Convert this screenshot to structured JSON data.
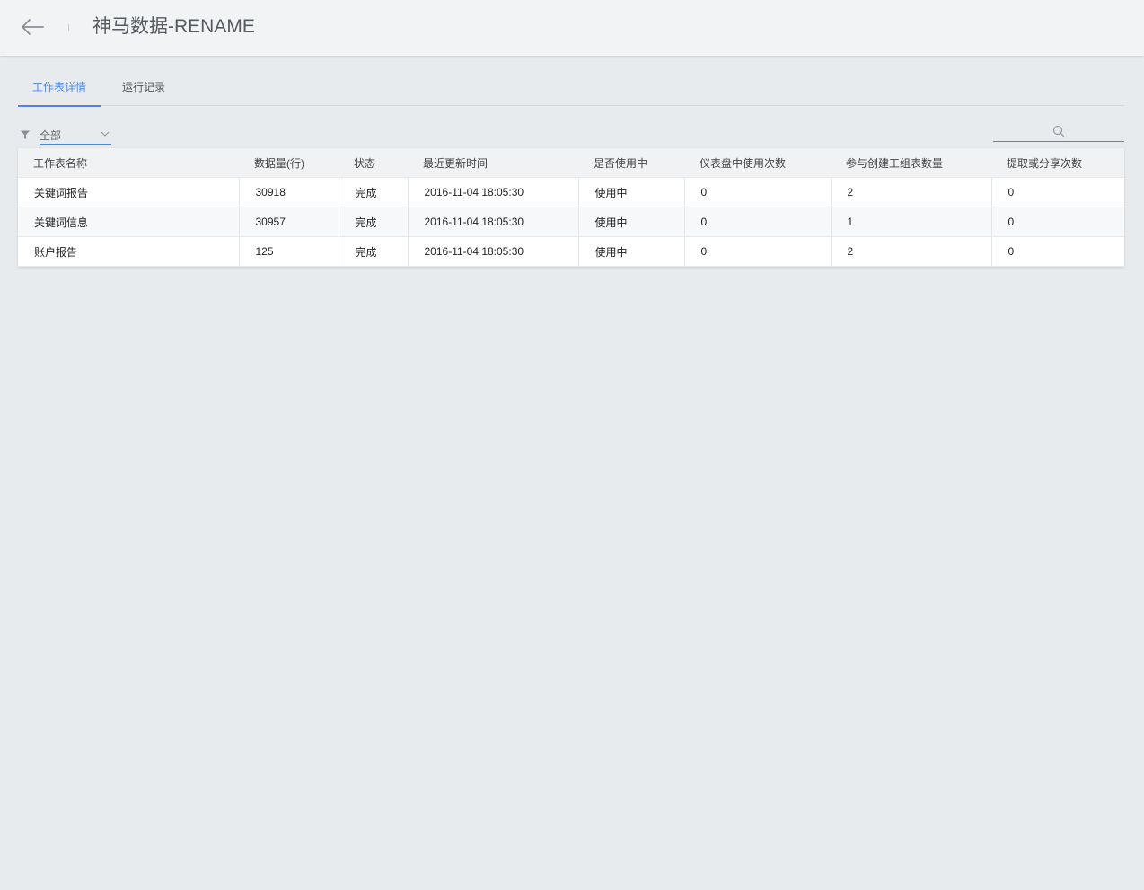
{
  "header": {
    "title": "神马数据-RENAME"
  },
  "tabs": [
    {
      "label": "工作表详情",
      "active": true
    },
    {
      "label": "运行记录",
      "active": false
    }
  ],
  "filter": {
    "selected": "全部"
  },
  "search": {
    "placeholder": ""
  },
  "table": {
    "columns": [
      "工作表名称",
      "数据量(行)",
      "状态",
      "最近更新时间",
      "是否使用中",
      "仪表盘中使用次数",
      "参与创建工组表数量",
      "提取或分享次数"
    ],
    "rows": [
      [
        "关键词报告",
        "30918",
        "完成",
        "2016-11-04 18:05:30",
        "使用中",
        "0",
        "2",
        "0"
      ],
      [
        "关键词信息",
        "30957",
        "完成",
        "2016-11-04 18:05:30",
        "使用中",
        "0",
        "1",
        "0"
      ],
      [
        "账户报告",
        "125",
        "完成",
        "2016-11-04 18:05:30",
        "使用中",
        "0",
        "2",
        "0"
      ]
    ]
  },
  "colors": {
    "accent": "#4a86e8",
    "background": "#e8ebee",
    "header_bg": "#f2f3f4"
  }
}
